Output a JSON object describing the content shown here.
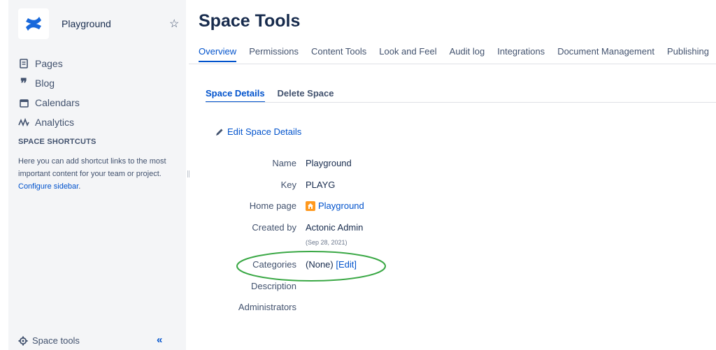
{
  "sidebar": {
    "space_name": "Playground",
    "nav": [
      {
        "label": "Pages",
        "icon": "pages-icon"
      },
      {
        "label": "Blog",
        "icon": "quote-icon"
      },
      {
        "label": "Calendars",
        "icon": "calendar-icon"
      },
      {
        "label": "Analytics",
        "icon": "analytics-icon"
      }
    ],
    "shortcuts_title": "SPACE SHORTCUTS",
    "shortcuts_text": "Here you can add shortcut links to the most important content for your team or project. ",
    "configure_link": "Configure sidebar",
    "configure_suffix": ".",
    "space_tools_label": "Space tools",
    "collapse_label": "«"
  },
  "main": {
    "title": "Space Tools",
    "tabs": [
      "Overview",
      "Permissions",
      "Content Tools",
      "Look and Feel",
      "Audit log",
      "Integrations",
      "Document Management",
      "Publishing"
    ],
    "subtabs": [
      "Space Details",
      "Delete Space"
    ],
    "edit_details_label": "Edit Space Details",
    "details": {
      "name_label": "Name",
      "name_value": "Playground",
      "key_label": "Key",
      "key_value": "PLAYG",
      "home_label": "Home page",
      "home_value": "Playground",
      "created_label": "Created by",
      "created_value": "Actonic Admin",
      "created_date": "(Sep 28, 2021)",
      "categories_label": "Categories",
      "categories_value": "(None)",
      "categories_edit": "[Edit]",
      "description_label": "Description",
      "administrators_label": "Administrators"
    }
  },
  "colors": {
    "accent": "#0052cc",
    "sidebar_bg": "#f4f5f7",
    "annotation": "#3aa845",
    "home_icon": "#ff991f"
  }
}
